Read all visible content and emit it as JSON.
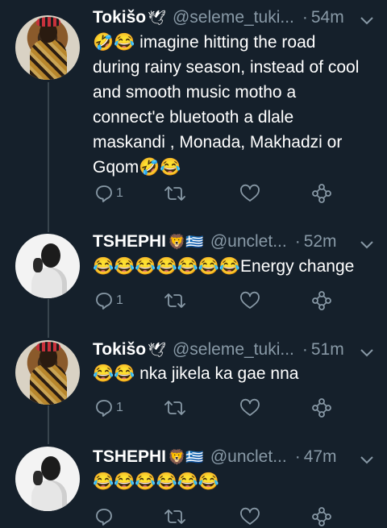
{
  "tweets": [
    {
      "name": "Tokišo",
      "badge": "🕊",
      "handle": "@seleme_tuki...",
      "sep": "·",
      "time": "54m",
      "text_lines": [
        "🤣😂 imagine hitting the road",
        "during rainy season, instead of cool",
        "and smooth music   motho a",
        "connect'e bluetooth a dlale",
        "maskandi , Monada, Makhadzi or",
        "Gqom🤣😂"
      ],
      "replies": "1"
    },
    {
      "name": "TSHEPHI",
      "badge": "🦁🇬🇷",
      "handle": "@unclet...",
      "sep": "·",
      "time": "52m",
      "text_lines": [
        "😂😂😂😂😂😂😂Energy change"
      ],
      "replies": "1"
    },
    {
      "name": "Tokišo",
      "badge": "🕊",
      "handle": "@seleme_tuki...",
      "sep": "·",
      "time": "51m",
      "text_lines": [
        "😂😂 nka jikela ka gae nna"
      ],
      "replies": "1"
    },
    {
      "name": "TSHEPHI",
      "badge": "🦁🇬🇷",
      "handle": "@unclet...",
      "sep": "·",
      "time": "47m",
      "text_lines": [
        "😂😂😂😂😂😂"
      ],
      "replies": ""
    }
  ],
  "colors": {
    "background": "#15202b",
    "secondary_text": "#8899a6",
    "thread_line": "#38444d"
  },
  "icons": [
    "reply-icon",
    "retweet-icon",
    "like-icon",
    "share-icon",
    "chevron-down-icon"
  ]
}
